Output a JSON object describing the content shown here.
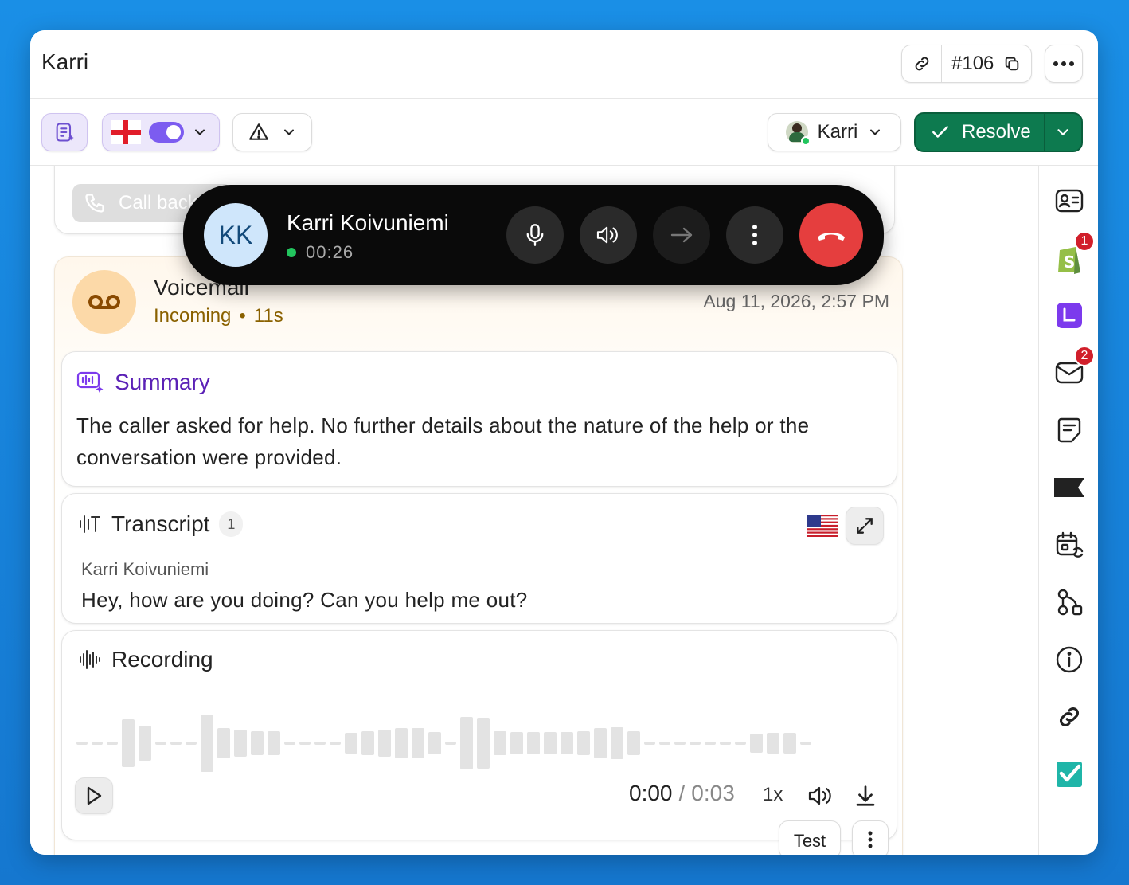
{
  "window": {
    "title": "Karri"
  },
  "ticket": {
    "number": "#106"
  },
  "toolbar": {
    "assignee": "Karri",
    "resolve_label": "Resolve"
  },
  "call": {
    "initials": "KK",
    "name": "Karri Koivuniemi",
    "duration": "00:26",
    "status_color": "#22c55e",
    "end_color": "#e53e3e"
  },
  "callback": {
    "label": "Call back"
  },
  "voicemail": {
    "title": "Voicemail",
    "direction": "Incoming",
    "length": "11s",
    "separator": "•",
    "timestamp": "Aug 11, 2026, 2:57 PM"
  },
  "summary": {
    "title": "Summary",
    "text": "The caller asked for help. No further details about the nature of the help or the conversation were provided."
  },
  "transcript": {
    "title": "Transcript",
    "count": "1",
    "speaker": "Karri Koivuniemi",
    "line": "Hey, how are you doing? Can you help me out?"
  },
  "recording": {
    "title": "Recording",
    "current": "0:00",
    "divider": "/",
    "total": "0:03",
    "speed": "1x",
    "progress": 0
  },
  "footer": {
    "test_label": "Test"
  },
  "rail": {
    "shopify_badge": "1",
    "mail_badge": "2"
  },
  "colors": {
    "accent_purple": "#6d28d9",
    "resolve_green": "#0d7a4f",
    "voicemail_orange": "#fcd9a8",
    "incoming_text": "#8a6100"
  }
}
